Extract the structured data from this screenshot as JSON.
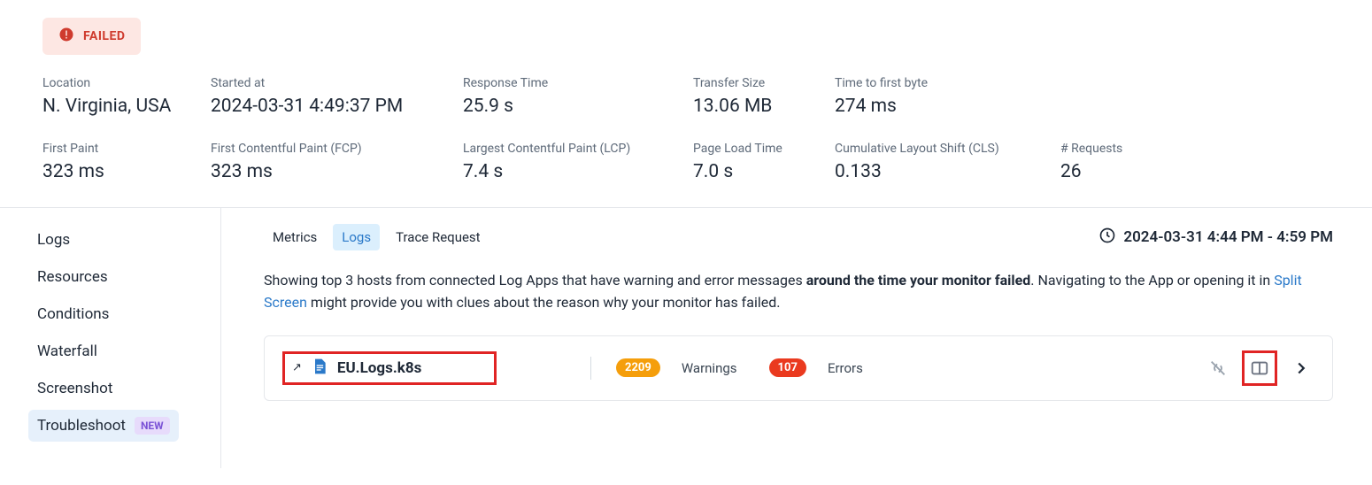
{
  "status": {
    "label": "FAILED"
  },
  "metrics": {
    "row1": [
      {
        "label": "Location",
        "value": "N. Virginia, USA"
      },
      {
        "label": "Started at",
        "value": "2024-03-31 4:49:37 PM"
      },
      {
        "label": "Response Time",
        "value": "25.9 s"
      },
      {
        "label": "Transfer Size",
        "value": "13.06 MB"
      },
      {
        "label": "Time to first byte",
        "value": "274 ms"
      }
    ],
    "row2": [
      {
        "label": "First Paint",
        "value": "323 ms"
      },
      {
        "label": "First Contentful Paint (FCP)",
        "value": "323 ms"
      },
      {
        "label": "Largest Contentful Paint (LCP)",
        "value": "7.4 s"
      },
      {
        "label": "Page Load Time",
        "value": "7.0 s"
      },
      {
        "label": "Cumulative Layout Shift (CLS)",
        "value": "0.133"
      },
      {
        "label": "# Requests",
        "value": "26"
      }
    ]
  },
  "sidebar": {
    "items": [
      {
        "label": "Logs"
      },
      {
        "label": "Resources"
      },
      {
        "label": "Conditions"
      },
      {
        "label": "Waterfall"
      },
      {
        "label": "Screenshot"
      },
      {
        "label": "Troubleshoot",
        "badge": "NEW"
      }
    ]
  },
  "tabs": {
    "items": [
      {
        "label": "Metrics"
      },
      {
        "label": "Logs",
        "active": true
      },
      {
        "label": "Trace Request"
      }
    ],
    "time_range": "2024-03-31 4:44 PM - 4:59 PM"
  },
  "description": {
    "prefix": "Showing top 3 hosts from connected Log Apps that have warning and error messages ",
    "bold": "around the time your monitor failed",
    "mid": ". Navigating to the App or opening it in ",
    "link": "Split Screen",
    "suffix": " might provide you with clues about the reason why your monitor has failed."
  },
  "log_card": {
    "source_name": "EU.Logs.k8s",
    "warnings_count": "2209",
    "warnings_label": "Warnings",
    "errors_count": "107",
    "errors_label": "Errors"
  }
}
